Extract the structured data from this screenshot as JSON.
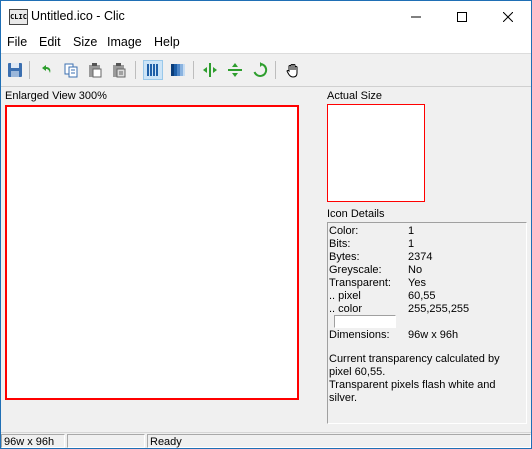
{
  "window": {
    "title": "Untitled.ico - Clic",
    "app_icon_text": "CLIC"
  },
  "menu": [
    "File",
    "Edit",
    "Size",
    "Image",
    "Help"
  ],
  "toolbar": {
    "icons": [
      "save-icon",
      "undo-icon",
      "copy-icon",
      "paste-icon",
      "paste-special-icon",
      "view-columns-icon",
      "view-gradient-icon",
      "flip-horizontal-icon",
      "flip-vertical-icon",
      "rotate-icon",
      "hand-icon"
    ]
  },
  "enlarged": {
    "label": "Enlarged View 300%"
  },
  "actual": {
    "label": "Actual Size"
  },
  "details": {
    "label": "Icon Details",
    "rows": [
      {
        "k": "Color:",
        "v": "1"
      },
      {
        "k": "Bits:",
        "v": "1"
      },
      {
        "k": "Bytes:",
        "v": "2374"
      },
      {
        "k": "Greyscale:",
        "v": "No"
      },
      {
        "k": "Transparent:",
        "v": "Yes"
      },
      {
        "k": ".. pixel",
        "v": "60,55"
      },
      {
        "k": ".. color",
        "v": "255,255,255"
      }
    ],
    "dimensions_label": "Dimensions:",
    "dimensions_value": "96w x 96h",
    "note_1": "Current transparency calculated by pixel 60,55.",
    "note_2": "Transparent pixels flash white and silver."
  },
  "status": {
    "size": "96w x 96h",
    "middle": "",
    "state": "Ready"
  },
  "colors": {
    "accent_border": "#ff0000",
    "pressed_button": "#cce4f7"
  }
}
